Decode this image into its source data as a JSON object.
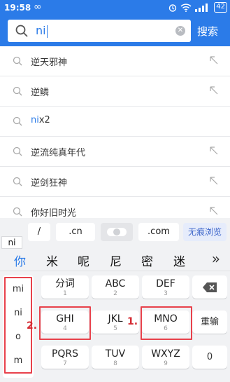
{
  "status": {
    "time": "19:58",
    "infinity": "∞",
    "battery": "42"
  },
  "search": {
    "query": "ni",
    "button": "搜索"
  },
  "suggestions": [
    {
      "text": "逆天邪神",
      "highlight": "",
      "rest": "逆天邪神"
    },
    {
      "text": "逆鳞",
      "highlight": "",
      "rest": "逆鳞"
    },
    {
      "text": "nix2",
      "highlight": "ni",
      "rest": "x2"
    },
    {
      "text": "逆流纯真年代",
      "highlight": "",
      "rest": "逆流纯真年代"
    },
    {
      "text": "逆剑狂神",
      "highlight": "",
      "rest": "逆剑狂神"
    },
    {
      "text": "你好旧时光",
      "highlight": "",
      "rest": "你好旧时光"
    }
  ],
  "keyboard": {
    "pinyin_tag": "ni",
    "quick": [
      "/",
      ".cn",
      ".com",
      "无痕浏览"
    ],
    "candidates": [
      "你",
      "米",
      "呢",
      "尼",
      "密",
      "迷"
    ],
    "more": "»",
    "pinyin_options": [
      "mi",
      "ni",
      "o",
      "m"
    ],
    "keys": [
      {
        "main": "分词",
        "num": "1"
      },
      {
        "main": "ABC",
        "num": "2"
      },
      {
        "main": "DEF",
        "num": "3"
      },
      {
        "main": "GHI",
        "num": "4"
      },
      {
        "main": "JKL",
        "num": "5"
      },
      {
        "main": "MNO",
        "num": "6"
      },
      {
        "main": "PQRS",
        "num": "7"
      },
      {
        "main": "TUV",
        "num": "8"
      },
      {
        "main": "WXYZ",
        "num": "9"
      }
    ],
    "side": {
      "retype": "重输",
      "zero": "0"
    }
  },
  "annotations": {
    "first": "1.",
    "second": "2."
  },
  "colors": {
    "accent": "#2b7be8",
    "annotation": "#e8414b"
  }
}
